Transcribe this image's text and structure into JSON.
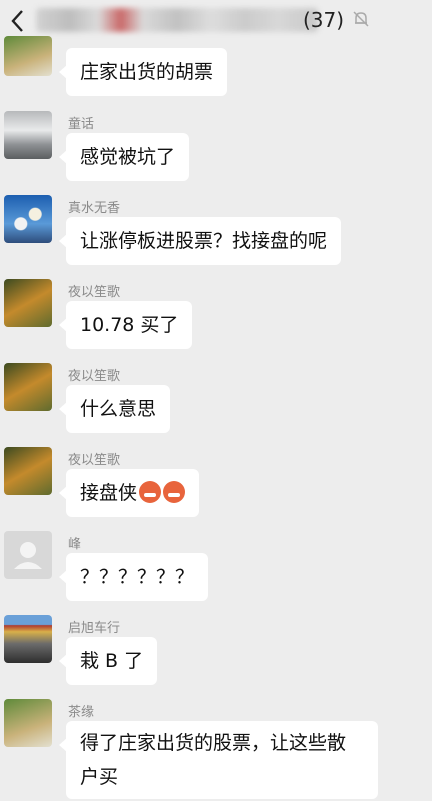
{
  "header": {
    "title_suffix": "(37)",
    "back_icon": "chevron-left-icon",
    "mute_icon": "bell-off-icon"
  },
  "messages": [
    {
      "sender": "",
      "text": "庄家出货的胡票"
    },
    {
      "sender": "童话",
      "text": "感觉被坑了"
    },
    {
      "sender": "真水无香",
      "text": "让涨停板进股票？找接盘的呢"
    },
    {
      "sender": "夜以笙歌",
      "text": "10.78 买了"
    },
    {
      "sender": "夜以笙歌",
      "text": "什么意思"
    },
    {
      "sender": "夜以笙歌",
      "text": "接盘侠"
    },
    {
      "sender": "峰",
      "text": "？？？？？？"
    },
    {
      "sender": "启旭车行",
      "text": "栽 B 了"
    },
    {
      "sender": "茶缘",
      "text": "得了庄家出货的股票，让这些散户买"
    }
  ]
}
